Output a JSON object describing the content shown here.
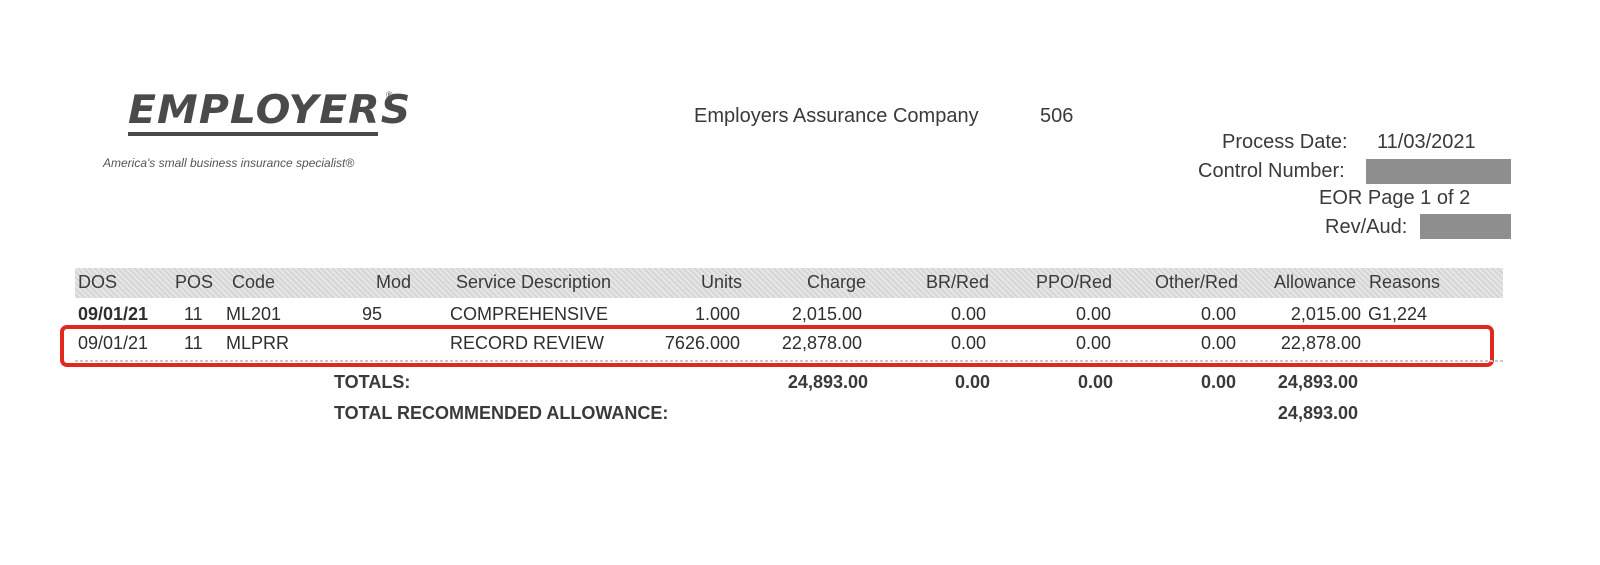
{
  "logo": {
    "wordmark": "EMPLOYERS",
    "registered": "®",
    "tagline": "America's small business insurance specialist®"
  },
  "header": {
    "company": "Employers Assurance Company",
    "company_code": "506",
    "process_date_label": "Process Date:",
    "process_date": "11/03/2021",
    "control_number_label": "Control Number:",
    "eor_page": "EOR Page 1 of 2",
    "rev_aud_label": "Rev/Aud:"
  },
  "table": {
    "columns": [
      "DOS",
      "POS",
      "Code",
      "Mod",
      "Service Description",
      "Units",
      "Charge",
      "BR/Red",
      "PPO/Red",
      "Other/Red",
      "Allowance",
      "Reasons"
    ],
    "rows": [
      [
        "09/01/21",
        "11",
        "ML201",
        "95",
        "COMPREHENSIVE",
        "1.000",
        "2,015.00",
        "0.00",
        "0.00",
        "0.00",
        "2,015.00",
        "G1,224"
      ],
      [
        "09/01/21",
        "11",
        "MLPRR",
        "",
        "RECORD REVIEW",
        "7626.000",
        "22,878.00",
        "0.00",
        "0.00",
        "0.00",
        "22,878.00",
        ""
      ]
    ]
  },
  "totals": {
    "label": "TOTALS:",
    "charge": "24,893.00",
    "br_red": "0.00",
    "ppo_red": "0.00",
    "other_red": "0.00",
    "allowance": "24,893.00",
    "recommended_label": "TOTAL RECOMMENDED ALLOWANCE:",
    "recommended_value": "24,893.00"
  },
  "highlight_color": "#e0281e"
}
